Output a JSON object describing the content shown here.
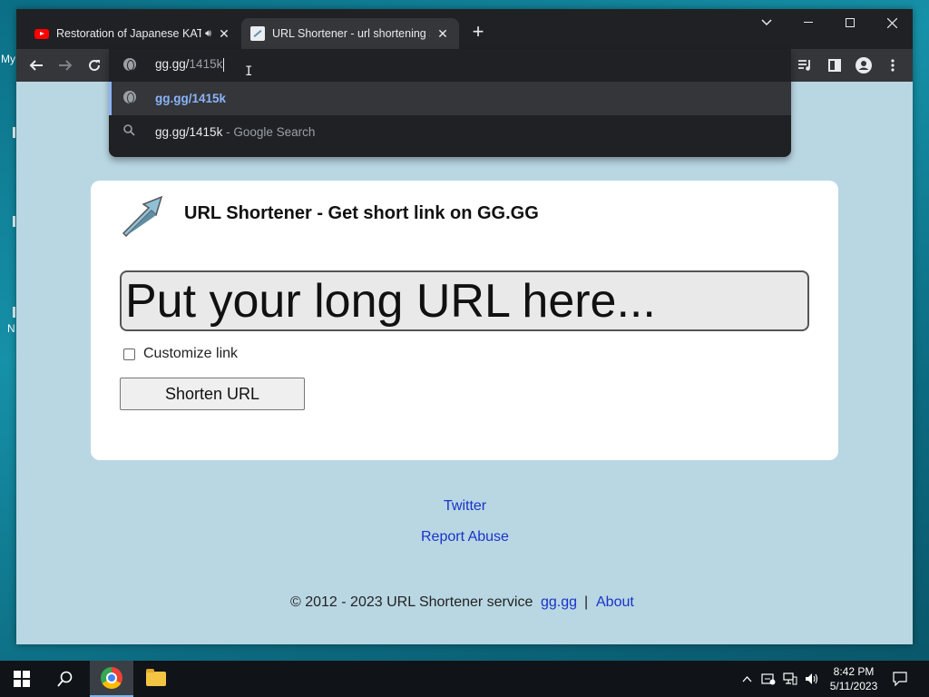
{
  "desktop": {
    "label_top": "My",
    "label_bottom": "N"
  },
  "tabs": [
    {
      "title": "Restoration of Japanese KATANA",
      "icon": "youtube-icon",
      "audio": true
    },
    {
      "title": "URL Shortener - url shortening service",
      "icon": "gg-favicon-icon"
    }
  ],
  "window_controls": {
    "list": "chevron-down-icon",
    "minimize": "minimize-icon",
    "maximize": "maximize-icon",
    "close": "close-icon"
  },
  "omnibox": {
    "typed": "gg.gg/",
    "autocomplete": "1415k",
    "suggestions": [
      {
        "text": "gg.gg/1415k",
        "suffix": "",
        "icon": "globe-icon",
        "selected": true
      },
      {
        "text": "gg.gg/1415k",
        "suffix": " - Google Search",
        "icon": "search-icon",
        "selected": false
      }
    ]
  },
  "page": {
    "title": "URL Shortener - Get short link on GG.GG",
    "url_placeholder": "Put your long URL here...",
    "customize_label": "Customize link",
    "shorten_button": "Shorten URL",
    "links": {
      "twitter": "Twitter",
      "report": "Report Abuse"
    },
    "footer": {
      "copyright": "© 2012 - 2023 URL Shortener service",
      "site": "gg.gg",
      "separator": "|",
      "about": "About"
    }
  },
  "taskbar": {
    "time": "8:42 PM",
    "date": "5/11/2023"
  },
  "colors": {
    "accent": "#8ab4f8",
    "link": "#1a33c7",
    "page_bg": "#b9d7e3"
  }
}
